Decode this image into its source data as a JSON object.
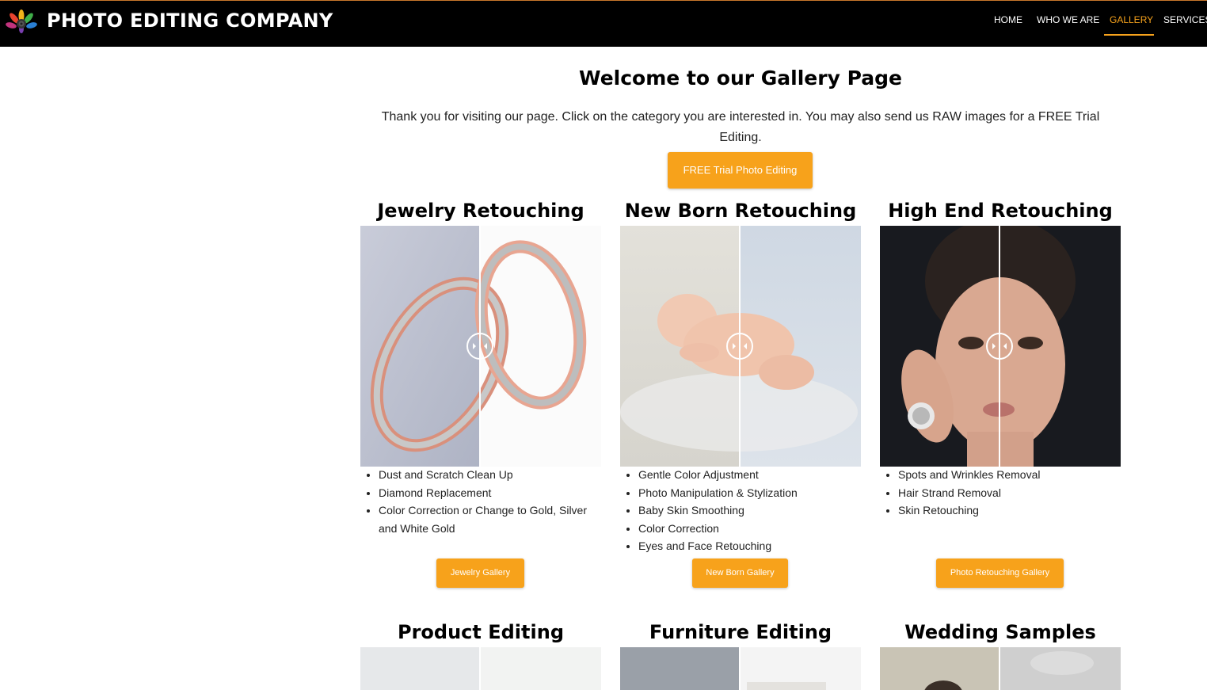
{
  "header": {
    "brand": "PHOTO EDITING COMPANY",
    "nav": [
      {
        "label": "HOME",
        "active": false
      },
      {
        "label": "WHO WE ARE",
        "active": false
      },
      {
        "label": "GALLERY",
        "active": true
      },
      {
        "label": "SERVICES",
        "active": false
      }
    ]
  },
  "intro": {
    "title": "Welcome to our Gallery Page",
    "text": "Thank you for visiting our page. Click on the category you are interested in. You may also send us RAW images for a FREE Trial Editing.",
    "cta": "FREE Trial Photo Editing"
  },
  "categories": [
    {
      "title": "Jewelry Retouching",
      "features": [
        "Dust and Scratch Clean Up",
        "Diamond Replacement",
        "Color Correction or Change to Gold, Silver and White Gold"
      ],
      "button": "Jewelry Gallery",
      "image": "wedding-rings-comparison"
    },
    {
      "title": "New Born Retouching",
      "features": [
        "Gentle Color Adjustment",
        "Photo Manipulation & Stylization",
        "Baby Skin Smoothing",
        "Color Correction",
        "Eyes and Face Retouching"
      ],
      "button": "New Born Gallery",
      "image": "sleeping-newborn-comparison"
    },
    {
      "title": "High End Retouching",
      "features": [
        "Spots and Wrinkles Removal",
        "Hair Strand Removal",
        "Skin Retouching"
      ],
      "button": "Photo Retouching Gallery",
      "image": "woman-portrait-comparison"
    },
    {
      "title": "Product Editing",
      "image": "product-comparison"
    },
    {
      "title": "Furniture Editing",
      "image": "furniture-comparison"
    },
    {
      "title": "Wedding Samples",
      "image": "wedding-comparison"
    }
  ],
  "colors": {
    "accent": "#f7a21b",
    "header_bg": "#000000"
  },
  "icons": [
    "logo-flower-icon",
    "compare-slider-handle-icon"
  ]
}
